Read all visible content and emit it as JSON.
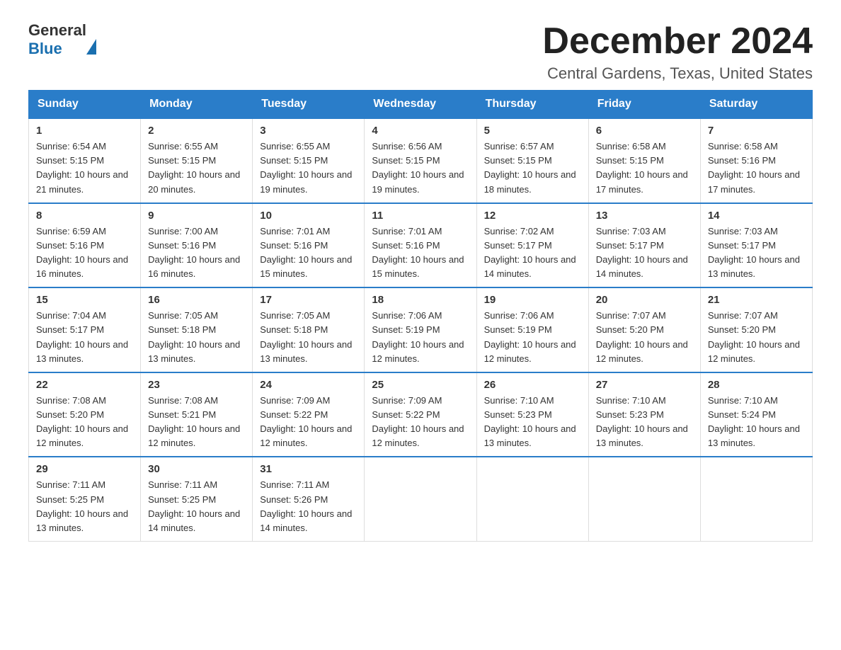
{
  "header": {
    "logo_text_general": "General",
    "logo_text_blue": "Blue",
    "title": "December 2024",
    "subtitle": "Central Gardens, Texas, United States"
  },
  "days_of_week": [
    "Sunday",
    "Monday",
    "Tuesday",
    "Wednesday",
    "Thursday",
    "Friday",
    "Saturday"
  ],
  "weeks": [
    [
      {
        "day": "1",
        "sunrise": "6:54 AM",
        "sunset": "5:15 PM",
        "daylight": "10 hours and 21 minutes."
      },
      {
        "day": "2",
        "sunrise": "6:55 AM",
        "sunset": "5:15 PM",
        "daylight": "10 hours and 20 minutes."
      },
      {
        "day": "3",
        "sunrise": "6:55 AM",
        "sunset": "5:15 PM",
        "daylight": "10 hours and 19 minutes."
      },
      {
        "day": "4",
        "sunrise": "6:56 AM",
        "sunset": "5:15 PM",
        "daylight": "10 hours and 19 minutes."
      },
      {
        "day": "5",
        "sunrise": "6:57 AM",
        "sunset": "5:15 PM",
        "daylight": "10 hours and 18 minutes."
      },
      {
        "day": "6",
        "sunrise": "6:58 AM",
        "sunset": "5:15 PM",
        "daylight": "10 hours and 17 minutes."
      },
      {
        "day": "7",
        "sunrise": "6:58 AM",
        "sunset": "5:16 PM",
        "daylight": "10 hours and 17 minutes."
      }
    ],
    [
      {
        "day": "8",
        "sunrise": "6:59 AM",
        "sunset": "5:16 PM",
        "daylight": "10 hours and 16 minutes."
      },
      {
        "day": "9",
        "sunrise": "7:00 AM",
        "sunset": "5:16 PM",
        "daylight": "10 hours and 16 minutes."
      },
      {
        "day": "10",
        "sunrise": "7:01 AM",
        "sunset": "5:16 PM",
        "daylight": "10 hours and 15 minutes."
      },
      {
        "day": "11",
        "sunrise": "7:01 AM",
        "sunset": "5:16 PM",
        "daylight": "10 hours and 15 minutes."
      },
      {
        "day": "12",
        "sunrise": "7:02 AM",
        "sunset": "5:17 PM",
        "daylight": "10 hours and 14 minutes."
      },
      {
        "day": "13",
        "sunrise": "7:03 AM",
        "sunset": "5:17 PM",
        "daylight": "10 hours and 14 minutes."
      },
      {
        "day": "14",
        "sunrise": "7:03 AM",
        "sunset": "5:17 PM",
        "daylight": "10 hours and 13 minutes."
      }
    ],
    [
      {
        "day": "15",
        "sunrise": "7:04 AM",
        "sunset": "5:17 PM",
        "daylight": "10 hours and 13 minutes."
      },
      {
        "day": "16",
        "sunrise": "7:05 AM",
        "sunset": "5:18 PM",
        "daylight": "10 hours and 13 minutes."
      },
      {
        "day": "17",
        "sunrise": "7:05 AM",
        "sunset": "5:18 PM",
        "daylight": "10 hours and 13 minutes."
      },
      {
        "day": "18",
        "sunrise": "7:06 AM",
        "sunset": "5:19 PM",
        "daylight": "10 hours and 12 minutes."
      },
      {
        "day": "19",
        "sunrise": "7:06 AM",
        "sunset": "5:19 PM",
        "daylight": "10 hours and 12 minutes."
      },
      {
        "day": "20",
        "sunrise": "7:07 AM",
        "sunset": "5:20 PM",
        "daylight": "10 hours and 12 minutes."
      },
      {
        "day": "21",
        "sunrise": "7:07 AM",
        "sunset": "5:20 PM",
        "daylight": "10 hours and 12 minutes."
      }
    ],
    [
      {
        "day": "22",
        "sunrise": "7:08 AM",
        "sunset": "5:20 PM",
        "daylight": "10 hours and 12 minutes."
      },
      {
        "day": "23",
        "sunrise": "7:08 AM",
        "sunset": "5:21 PM",
        "daylight": "10 hours and 12 minutes."
      },
      {
        "day": "24",
        "sunrise": "7:09 AM",
        "sunset": "5:22 PM",
        "daylight": "10 hours and 12 minutes."
      },
      {
        "day": "25",
        "sunrise": "7:09 AM",
        "sunset": "5:22 PM",
        "daylight": "10 hours and 12 minutes."
      },
      {
        "day": "26",
        "sunrise": "7:10 AM",
        "sunset": "5:23 PM",
        "daylight": "10 hours and 13 minutes."
      },
      {
        "day": "27",
        "sunrise": "7:10 AM",
        "sunset": "5:23 PM",
        "daylight": "10 hours and 13 minutes."
      },
      {
        "day": "28",
        "sunrise": "7:10 AM",
        "sunset": "5:24 PM",
        "daylight": "10 hours and 13 minutes."
      }
    ],
    [
      {
        "day": "29",
        "sunrise": "7:11 AM",
        "sunset": "5:25 PM",
        "daylight": "10 hours and 13 minutes."
      },
      {
        "day": "30",
        "sunrise": "7:11 AM",
        "sunset": "5:25 PM",
        "daylight": "10 hours and 14 minutes."
      },
      {
        "day": "31",
        "sunrise": "7:11 AM",
        "sunset": "5:26 PM",
        "daylight": "10 hours and 14 minutes."
      },
      null,
      null,
      null,
      null
    ]
  ]
}
